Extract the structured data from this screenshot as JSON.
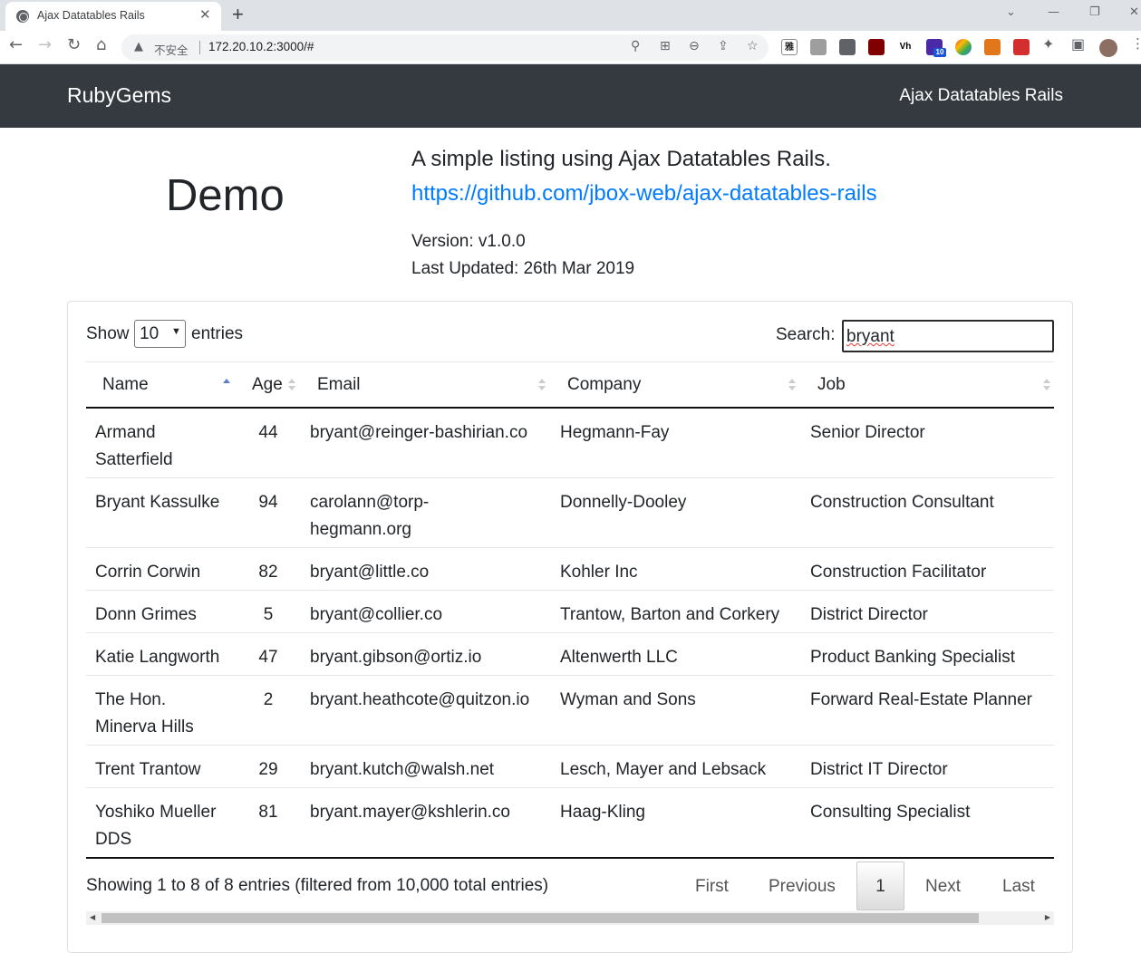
{
  "browser": {
    "tab_title": "Ajax Datatables Rails",
    "new_tab": "+",
    "close": "✕",
    "security_label": "不安全",
    "url": "172.20.10.2:3000/#",
    "extension_badge": "10"
  },
  "navbar": {
    "brand": "RubyGems",
    "right_link": "Ajax Datatables Rails"
  },
  "header": {
    "title": "Demo",
    "description": "A simple listing using Ajax Datatables Rails.",
    "repo_link": "https://github.com/jbox-web/ajax-datatables-rails",
    "version": "Version: v1.0.0",
    "last_updated": "Last Updated: 26th Mar 2019"
  },
  "table_controls": {
    "show_label": "Show",
    "entries_label": "entries",
    "page_length": "10",
    "search_label": "Search:",
    "search_value": "bryant"
  },
  "columns": [
    "Name",
    "Age",
    "Email",
    "Company",
    "Job"
  ],
  "rows": [
    {
      "name": [
        "Armand",
        "Satterfield"
      ],
      "age": "44",
      "email": [
        "bryant@reinger-bashirian.co"
      ],
      "company": "Hegmann-Fay",
      "job": "Senior Director"
    },
    {
      "name": [
        "Bryant Kassulke"
      ],
      "age": "94",
      "email": [
        "carolann@torp-",
        "hegmann.org"
      ],
      "company": "Donnelly-Dooley",
      "job": "Construction Consultant"
    },
    {
      "name": [
        "Corrin Corwin"
      ],
      "age": "82",
      "email": [
        "bryant@little.co"
      ],
      "company": "Kohler Inc",
      "job": "Construction Facilitator"
    },
    {
      "name": [
        "Donn Grimes"
      ],
      "age": "5",
      "email": [
        "bryant@collier.co"
      ],
      "company": "Trantow, Barton and Corkery",
      "job": "District Director"
    },
    {
      "name": [
        "Katie Langworth"
      ],
      "age": "47",
      "email": [
        "bryant.gibson@ortiz.io"
      ],
      "company": "Altenwerth LLC",
      "job": "Product Banking Specialist"
    },
    {
      "name": [
        "The Hon.",
        "Minerva Hills"
      ],
      "age": "2",
      "email": [
        "bryant.heathcote@quitzon.io"
      ],
      "company": "Wyman and Sons",
      "job": "Forward Real-Estate Planner"
    },
    {
      "name": [
        "Trent Trantow"
      ],
      "age": "29",
      "email": [
        "bryant.kutch@walsh.net"
      ],
      "company": "Lesch, Mayer and Lebsack",
      "job": "District IT Director"
    },
    {
      "name": [
        "Yoshiko Mueller",
        "DDS"
      ],
      "age": "81",
      "email": [
        "bryant.mayer@kshlerin.co"
      ],
      "company": "Haag-Kling",
      "job": "Consulting Specialist"
    }
  ],
  "footer": {
    "info": "Showing 1 to 8 of 8 entries (filtered from 10,000 total entries)",
    "first": "First",
    "previous": "Previous",
    "current_page": "1",
    "next": "Next",
    "last": "Last"
  }
}
